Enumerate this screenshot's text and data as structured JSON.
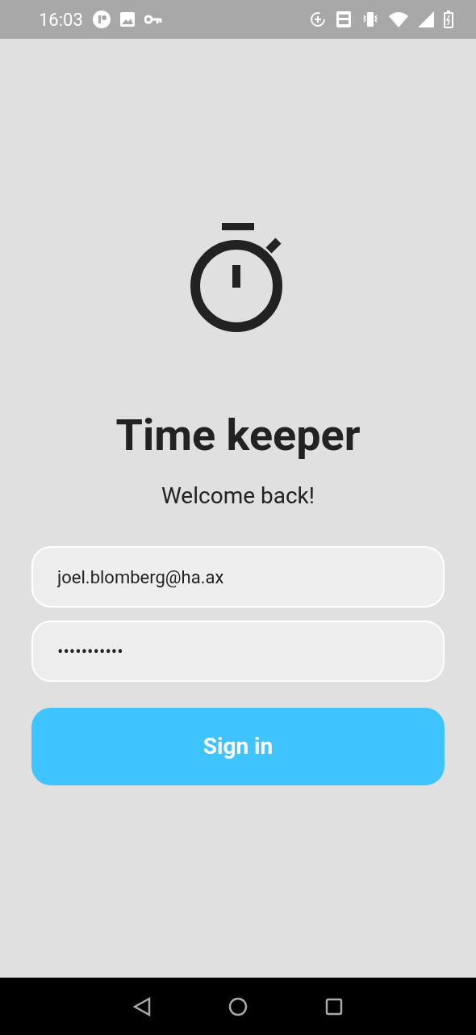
{
  "status_bar": {
    "time": "16:03"
  },
  "app": {
    "title": "Time keeper",
    "subtitle": "Welcome back!"
  },
  "form": {
    "email": {
      "value": "joel.blomberg@ha.ax"
    },
    "password": {
      "value": "•••••••••••"
    },
    "submit": "Sign in"
  }
}
